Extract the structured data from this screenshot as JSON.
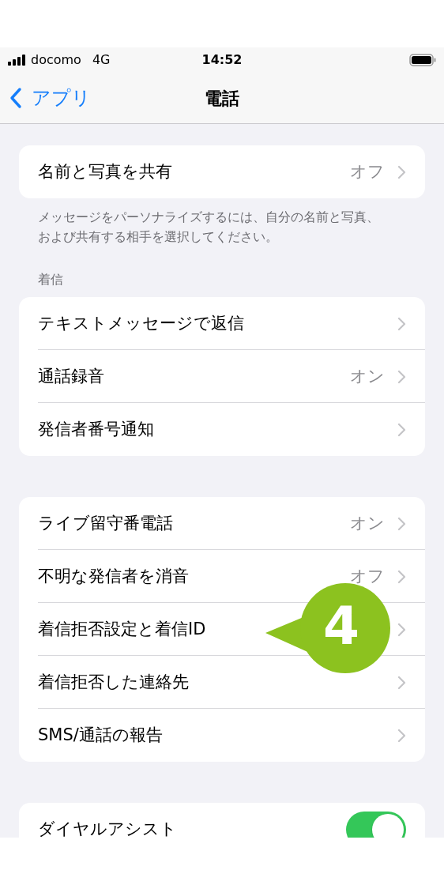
{
  "status_bar": {
    "carrier": "docomo",
    "network": "4G",
    "time": "14:52"
  },
  "nav": {
    "back": "アプリ",
    "title": "電話"
  },
  "groups": [
    {
      "rows": [
        {
          "kind": "link",
          "label": "名前と写真を共有",
          "value": "オフ"
        }
      ],
      "footer": "メッセージをパーソナライズするには、自分の名前と写真、および共有する相手を選択してください。"
    },
    {
      "header": "着信",
      "rows": [
        {
          "kind": "link",
          "label": "テキストメッセージで返信"
        },
        {
          "kind": "link",
          "label": "通話録音",
          "value": "オン"
        },
        {
          "kind": "link",
          "label": "発信者番号通知"
        }
      ]
    },
    {
      "rows": [
        {
          "kind": "link",
          "label": "ライブ留守番電話",
          "value": "オン"
        },
        {
          "kind": "link",
          "label": "不明な発信者を消音",
          "value": "オフ"
        },
        {
          "kind": "link",
          "label": "着信拒否設定と着信ID"
        },
        {
          "kind": "link",
          "label": "着信拒否した連絡先"
        },
        {
          "kind": "link",
          "label": "SMS/通話の報告"
        }
      ]
    },
    {
      "rows": [
        {
          "kind": "toggle",
          "label": "ダイヤルアシスト",
          "on": true
        }
      ]
    }
  ],
  "callout": {
    "number": "4"
  }
}
